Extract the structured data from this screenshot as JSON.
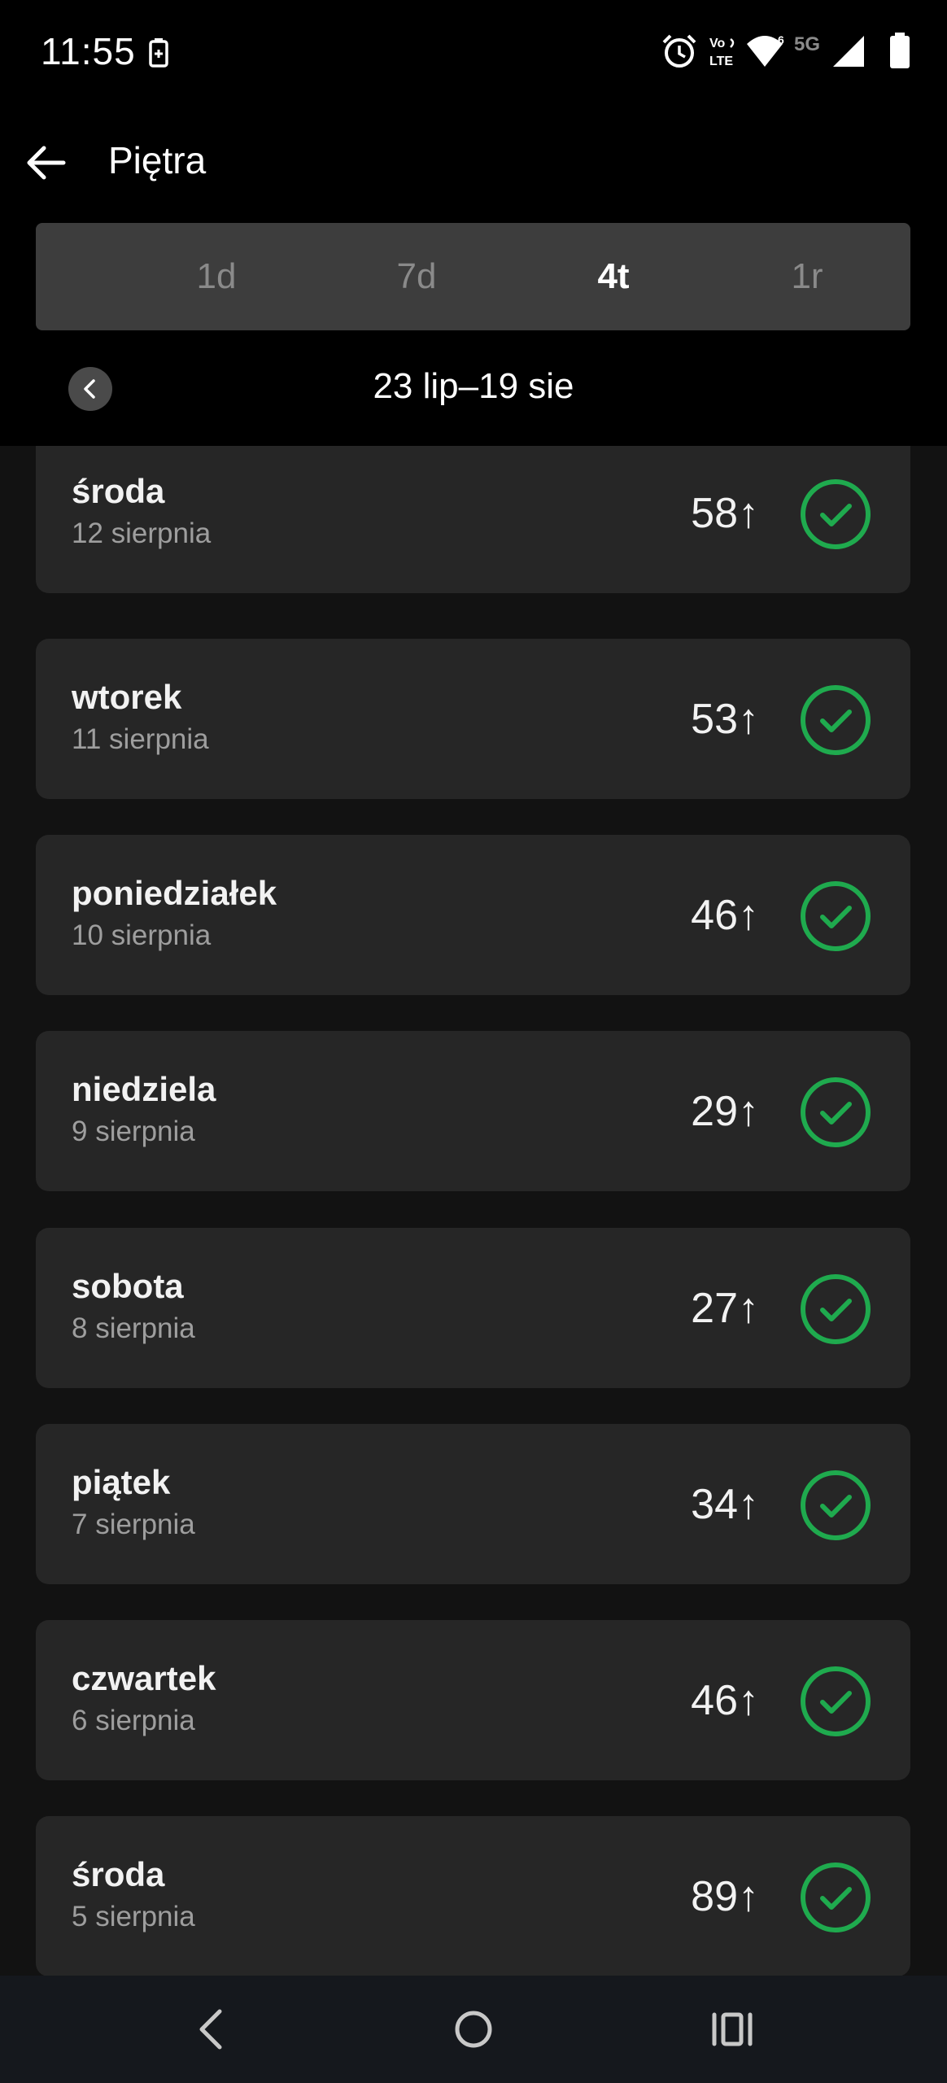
{
  "status_bar": {
    "time": "11:55",
    "network": "5G",
    "icons": [
      "battery-saver-icon",
      "alarm-icon",
      "volte-icon",
      "wifi-icon",
      "signal-icon",
      "battery-icon"
    ]
  },
  "app_bar": {
    "title": "Piętra",
    "back_icon": "arrow-left-icon"
  },
  "range_tabs": [
    {
      "label": "1d",
      "active": false
    },
    {
      "label": "7d",
      "active": false
    },
    {
      "label": "4t",
      "active": true
    },
    {
      "label": "1r",
      "active": false
    }
  ],
  "period": {
    "label": "23 lip–19 sie",
    "prev_icon": "chevron-left-icon"
  },
  "days": [
    {
      "name": "środa",
      "date": "12 sierpnia",
      "value": "58↑",
      "status": "goal-reached"
    },
    {
      "name": "wtorek",
      "date": "11 sierpnia",
      "value": "53↑",
      "status": "goal-reached"
    },
    {
      "name": "poniedziałek",
      "date": "10 sierpnia",
      "value": "46↑",
      "status": "goal-reached"
    },
    {
      "name": "niedziela",
      "date": "9 sierpnia",
      "value": "29↑",
      "status": "goal-reached"
    },
    {
      "name": "sobota",
      "date": "8 sierpnia",
      "value": "27↑",
      "status": "goal-reached"
    },
    {
      "name": "piątek",
      "date": "7 sierpnia",
      "value": "34↑",
      "status": "goal-reached"
    },
    {
      "name": "czwartek",
      "date": "6 sierpnia",
      "value": "46↑",
      "status": "goal-reached"
    },
    {
      "name": "środa",
      "date": "5 sierpnia",
      "value": "89↑",
      "status": "goal-reached"
    }
  ],
  "colors": {
    "background": "#121212",
    "header": "#000000",
    "card": "#262626",
    "tabs_bg": "#3d3d3d",
    "accent_green": "#1faa4e",
    "nav_bar": "#15181d"
  },
  "nav_bar": {
    "icons": [
      "back-nav-icon",
      "home-nav-icon",
      "recents-nav-icon"
    ]
  }
}
